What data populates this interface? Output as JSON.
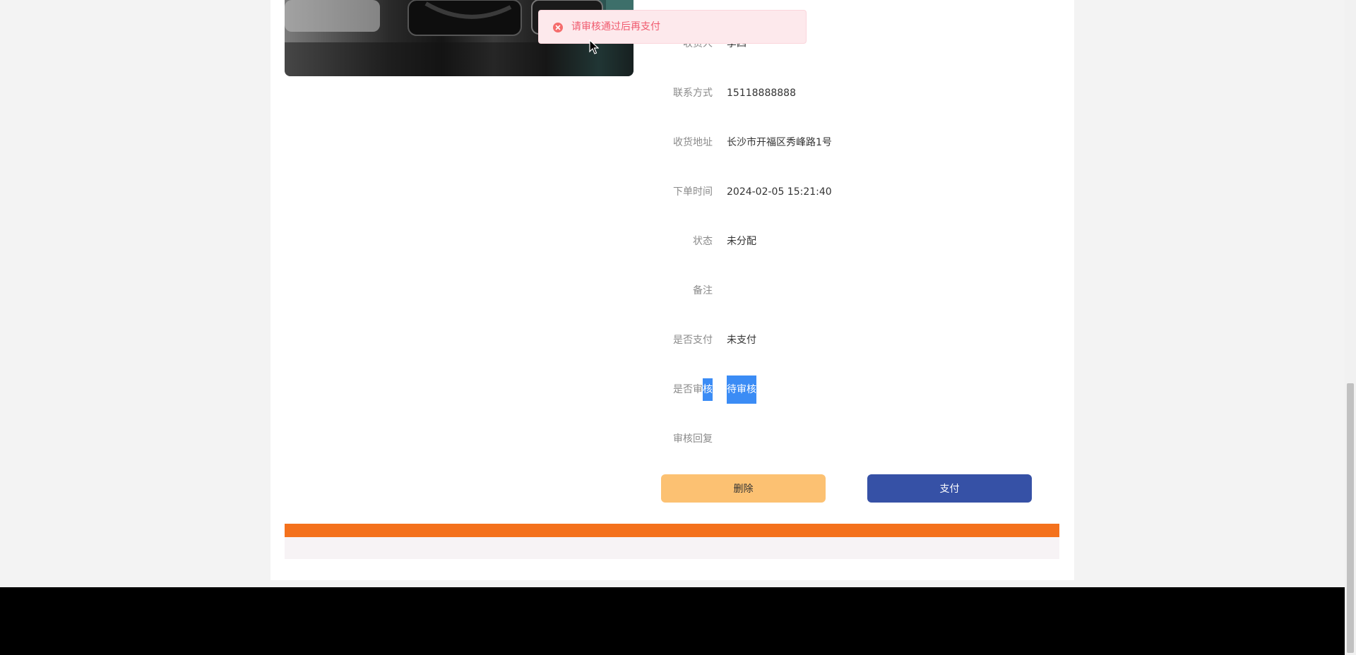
{
  "order": {
    "receiver_label": "收货人",
    "receiver_value": "李四",
    "phone_label": "联系方式",
    "phone_value": "15118888888",
    "address_label": "收货地址",
    "address_value": "长沙市开福区秀峰路1号",
    "order_time_label": "下单时间",
    "order_time_value": "2024-02-05 15:21:40",
    "status_label": "状态",
    "status_value": "未分配",
    "remark_label": "备注",
    "remark_value": "",
    "paid_label": "是否支付",
    "paid_value": "未支付",
    "review_label_prefix": "是否审",
    "review_label_highlight": "核",
    "review_value": "待审核",
    "review_reply_label": "审核回复",
    "review_reply_value": ""
  },
  "actions": {
    "delete_label": "删除",
    "pay_label": "支付"
  },
  "toast": {
    "message": "请审核通过后再支付",
    "icon": "error-circle-icon",
    "color": "#f05a6e"
  },
  "colors": {
    "delete_button": "#fcc172",
    "pay_button": "#3651a6",
    "footer_bar": "#f4711c",
    "selection_highlight": "#3b8cf5"
  }
}
